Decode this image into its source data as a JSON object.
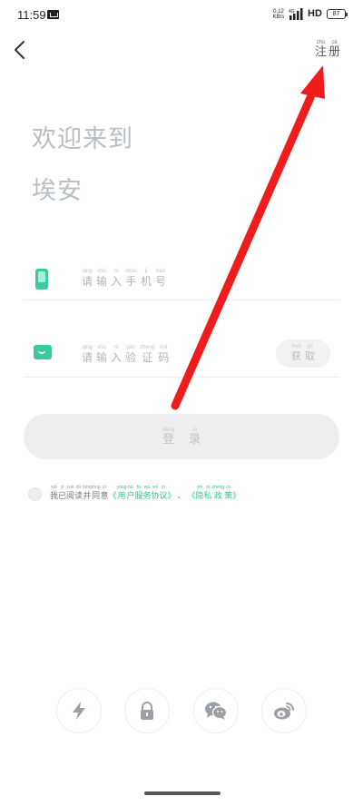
{
  "status_bar": {
    "time": "11:59",
    "net_speed": "0.12",
    "net_unit": "KB/s",
    "network": "HD",
    "battery": "87"
  },
  "header": {
    "register": [
      {
        "char": "注",
        "pinyin": "zhù"
      },
      {
        "char": "册",
        "pinyin": "cè"
      }
    ]
  },
  "welcome": {
    "line1": "欢迎来到",
    "line2": "埃安"
  },
  "phone_field": {
    "placeholder": [
      {
        "char": "请",
        "pinyin": "qǐng"
      },
      {
        "char": "输",
        "pinyin": "shū"
      },
      {
        "char": "入",
        "pinyin": "rù"
      },
      {
        "char": "手",
        "pinyin": "shǒu"
      },
      {
        "char": "机",
        "pinyin": "jī"
      },
      {
        "char": "号",
        "pinyin": "hào"
      }
    ]
  },
  "code_field": {
    "placeholder": [
      {
        "char": "请",
        "pinyin": "qǐng"
      },
      {
        "char": "输",
        "pinyin": "shū"
      },
      {
        "char": "入",
        "pinyin": "rù"
      },
      {
        "char": "验",
        "pinyin": "yàn"
      },
      {
        "char": "证",
        "pinyin": "zhèng"
      },
      {
        "char": "码",
        "pinyin": "mǎ"
      }
    ],
    "get_code": [
      {
        "char": "获",
        "pinyin": "huò"
      },
      {
        "char": "取",
        "pinyin": "qǔ"
      }
    ]
  },
  "login_button": {
    "label": [
      {
        "char": "登",
        "pinyin": "dēng"
      },
      {
        "char": "录",
        "pinyin": "lù"
      }
    ]
  },
  "agreement": {
    "prefix": [
      {
        "char": "我",
        "pinyin": "wǒ"
      },
      {
        "char": "已",
        "pinyin": "yǐ"
      },
      {
        "char": "阅",
        "pinyin": "yuè"
      },
      {
        "char": "读",
        "pinyin": "dú"
      },
      {
        "char": "并",
        "pinyin": "bìng"
      },
      {
        "char": "同",
        "pinyin": "tóng"
      },
      {
        "char": "意",
        "pinyin": "yì"
      }
    ],
    "open_bracket": "《",
    "close_bracket": "》",
    "service": [
      {
        "char": "用",
        "pinyin": "yòng"
      },
      {
        "char": "户",
        "pinyin": "hù"
      },
      {
        "char": "服",
        "pinyin": "fú"
      },
      {
        "char": "务",
        "pinyin": "wù"
      },
      {
        "char": "协",
        "pinyin": "xié"
      },
      {
        "char": "议",
        "pinyin": "yì"
      }
    ],
    "separator": "、",
    "privacy": [
      {
        "char": "隐",
        "pinyin": "yǐn"
      },
      {
        "char": "私",
        "pinyin": "sī"
      },
      {
        "char": "政",
        "pinyin": "zhèng"
      },
      {
        "char": "策",
        "pinyin": "cè"
      }
    ]
  },
  "social_logins": [
    {
      "icon": "lightning-icon"
    },
    {
      "icon": "lock-icon"
    },
    {
      "icon": "wechat-icon"
    },
    {
      "icon": "weibo-icon"
    }
  ],
  "colors": {
    "accent": "#3cc9a1",
    "link": "#37c39a",
    "annotation_arrow": "#ee1c1c"
  }
}
